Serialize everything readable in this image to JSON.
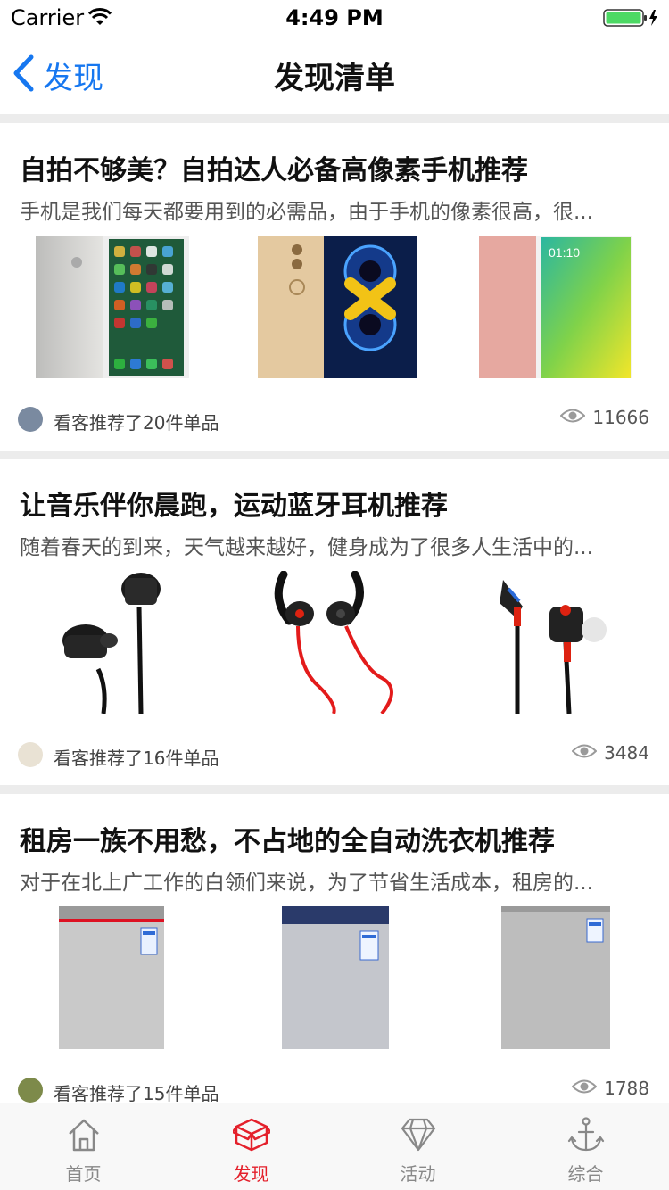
{
  "status_bar": {
    "carrier": "Carrier",
    "time": "4:49 PM"
  },
  "nav": {
    "back_label": "发现",
    "title": "发现清单"
  },
  "cards": [
    {
      "title": "自拍不够美？自拍达人必备高像素手机推荐",
      "description": "手机是我们每天都要用到的必需品，由于手机的像素很高，很...",
      "footer": "看客推荐了20件单品",
      "views": "11666"
    },
    {
      "title": "让音乐伴你晨跑，运动蓝牙耳机推荐",
      "description": "随着春天的到来，天气越来越好，健身成为了很多人生活中的...",
      "footer": "看客推荐了16件单品",
      "views": "3484"
    },
    {
      "title": "租房一族不用愁，不占地的全自动洗衣机推荐",
      "description": "对于在北上广工作的白领们来说，为了节省生活成本，租房的...",
      "footer": "看客推荐了15件单品",
      "views": "1788"
    }
  ],
  "tabs": [
    {
      "label": "首页",
      "icon": "home-icon",
      "active": false
    },
    {
      "label": "发现",
      "icon": "box-icon",
      "active": true
    },
    {
      "label": "活动",
      "icon": "diamond-icon",
      "active": false
    },
    {
      "label": "综合",
      "icon": "anchor-icon",
      "active": false
    }
  ],
  "colors": {
    "accent": "#e4202b",
    "link": "#1677f0",
    "separator": "#ececec"
  }
}
